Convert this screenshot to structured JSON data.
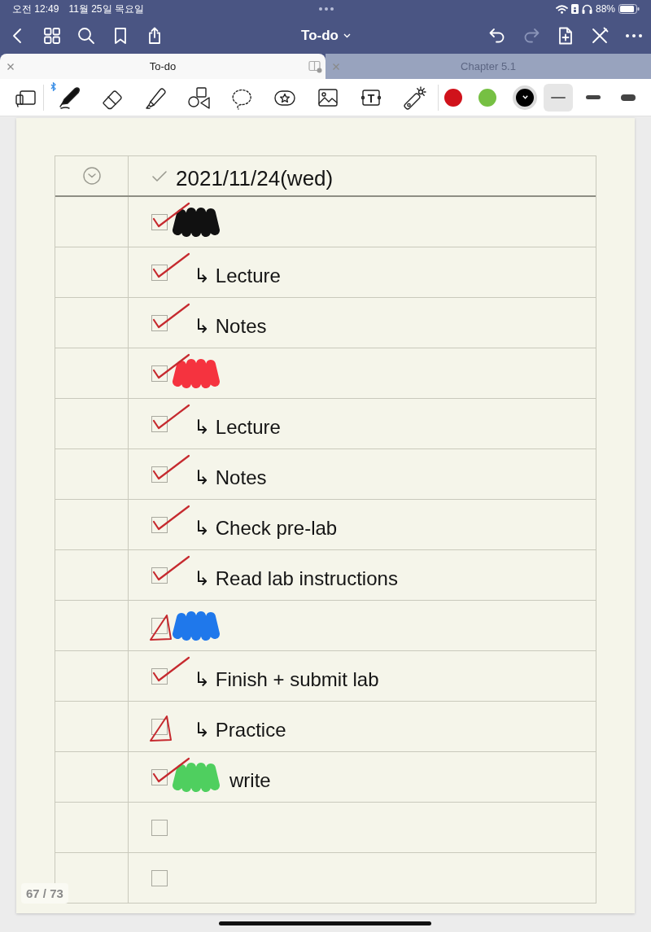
{
  "status_bar": {
    "time": "오전 12:49",
    "date": "11월 25일 목요일",
    "battery": "88%"
  },
  "nav_bar": {
    "title": "To-do",
    "undo": {
      "disabled": false
    },
    "redo": {
      "disabled": true
    }
  },
  "tabs": [
    {
      "label": "To-do",
      "selected": true
    },
    {
      "label": "Chapter 5.1",
      "selected": false
    }
  ],
  "toolbar": {
    "tools": [
      {
        "kind": "pages",
        "selected": false
      },
      {
        "kind": "pen",
        "selected": true
      },
      {
        "kind": "eraser",
        "selected": false
      },
      {
        "kind": "highlighter",
        "selected": false
      },
      {
        "kind": "shapes",
        "selected": false
      },
      {
        "kind": "lasso",
        "selected": false
      },
      {
        "kind": "sticker",
        "selected": false
      },
      {
        "kind": "image",
        "selected": false
      },
      {
        "kind": "text-box",
        "selected": false,
        "glyph": "T"
      },
      {
        "kind": "laser-pointer",
        "selected": false
      }
    ],
    "colors": [
      {
        "color": "#d0121b",
        "selected": false
      },
      {
        "color": "#76c043",
        "selected": false
      },
      {
        "color": "#000000",
        "selected": true
      }
    ],
    "strokes": [
      {
        "kind": "thin",
        "selected": true
      },
      {
        "kind": "medium",
        "selected": false
      },
      {
        "kind": "thick",
        "selected": false
      }
    ]
  },
  "page": {
    "date": "2021/11/24(wed)",
    "rows": [
      {
        "checked": true,
        "partial": false,
        "color": "#111111"
      },
      {
        "checked": true,
        "partial": false,
        "text": "↳ Lecture"
      },
      {
        "checked": true,
        "partial": false,
        "text": "↳ Notes"
      },
      {
        "checked": true,
        "partial": false,
        "color": "#f5333f"
      },
      {
        "checked": true,
        "partial": false,
        "text": "↳ Lecture"
      },
      {
        "checked": true,
        "partial": false,
        "text": "↳ Notes"
      },
      {
        "checked": true,
        "partial": false,
        "text": "↳ Check pre-lab"
      },
      {
        "checked": true,
        "partial": false,
        "text": "↳ Read lab instructions"
      },
      {
        "checked": true,
        "partial": true,
        "color": "#1f78eb"
      },
      {
        "checked": true,
        "partial": false,
        "text": "↳ Finish + submit lab"
      },
      {
        "checked": true,
        "partial": true,
        "text": "↳ Practice"
      },
      {
        "checked": true,
        "partial": false,
        "color": "#4fcf5f",
        "text": "write"
      },
      {
        "checked": false,
        "partial": false
      },
      {
        "checked": false,
        "partial": false
      }
    ]
  },
  "page_counter": "67 / 73"
}
